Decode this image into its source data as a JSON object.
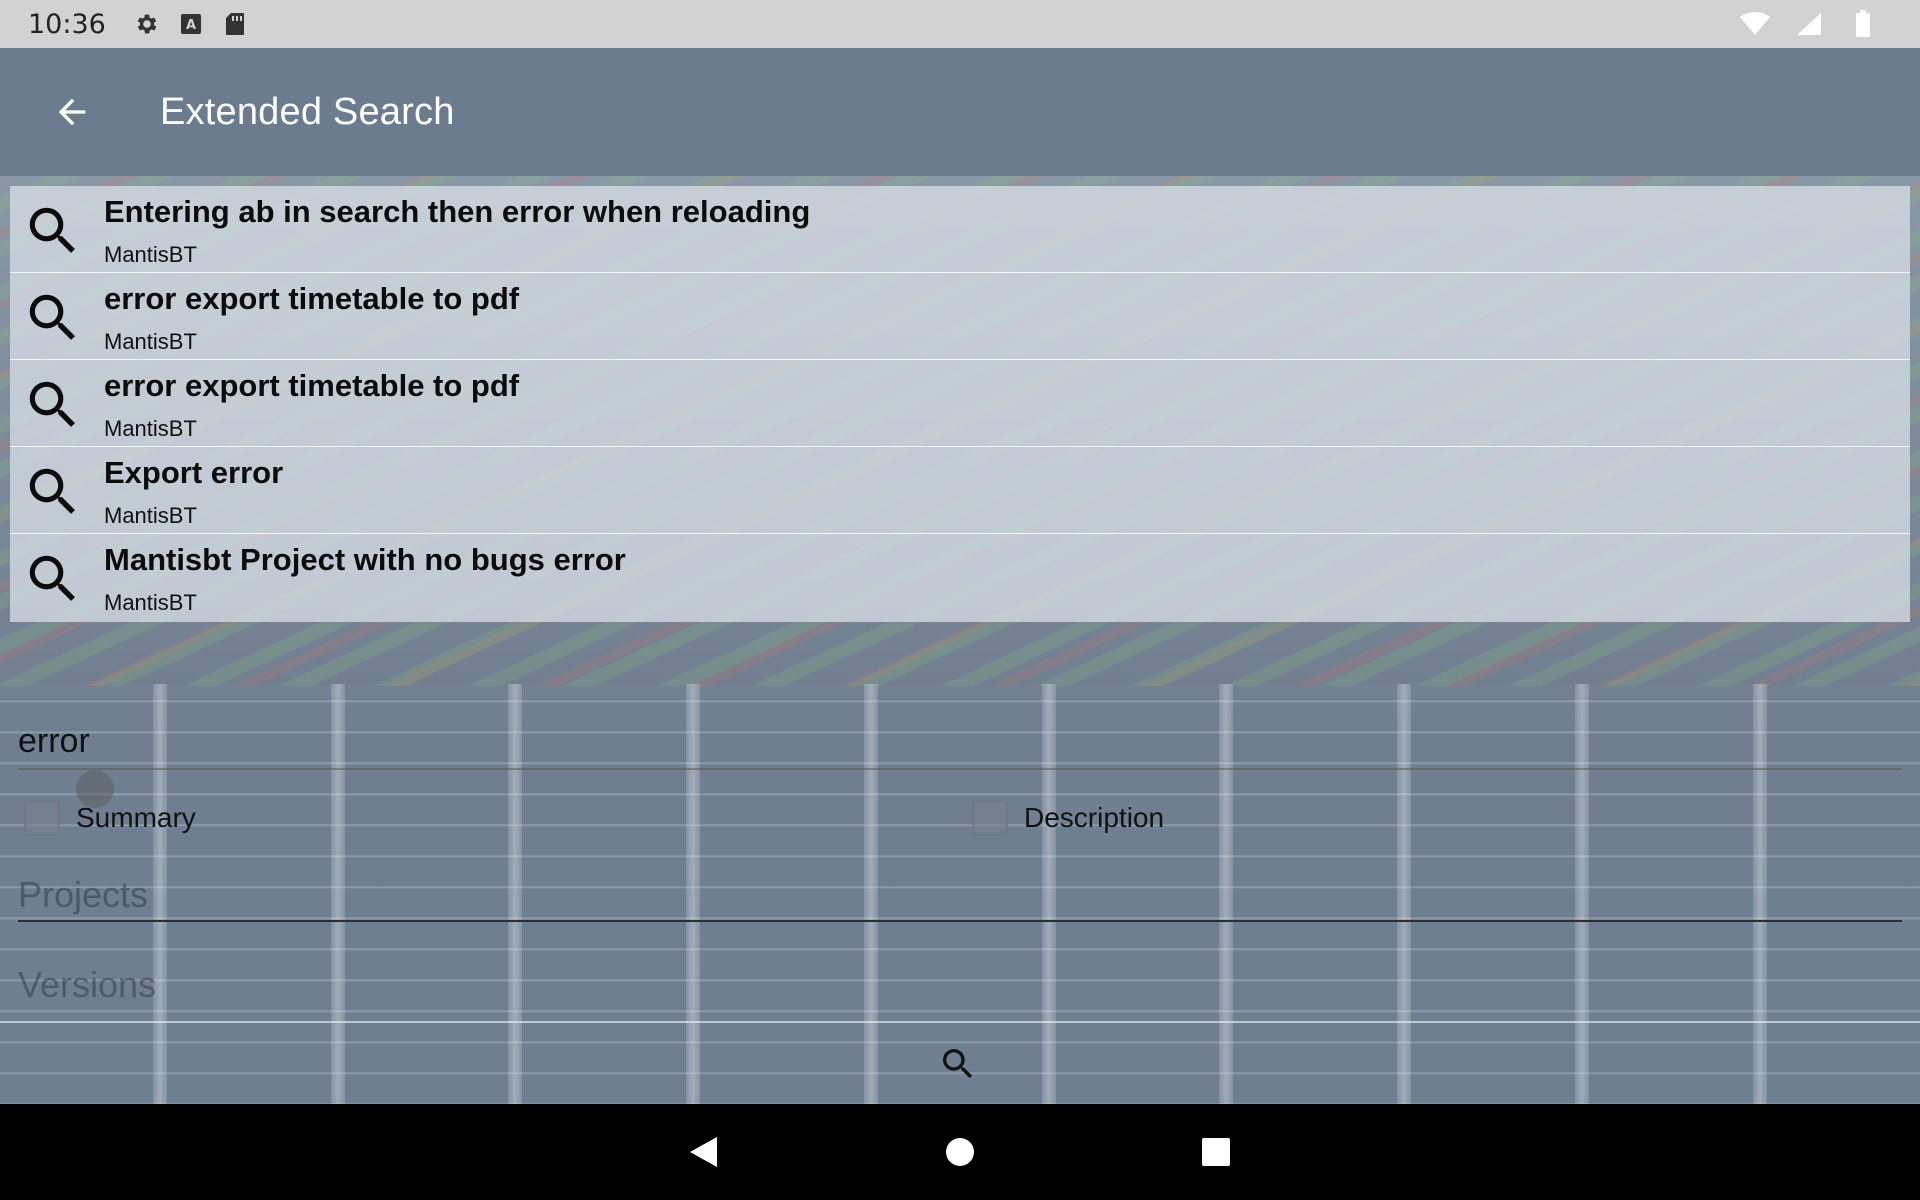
{
  "status_bar": {
    "time": "10:36",
    "icons_left": [
      "gear-icon",
      "keyboard-a-icon",
      "sd-card-icon"
    ],
    "icons_right": [
      "wifi-icon",
      "cell-signal-icon",
      "battery-icon"
    ]
  },
  "app_bar": {
    "title": "Extended Search",
    "back_icon": "arrow-back-icon"
  },
  "suggestions": [
    {
      "title": "Entering ab in search then error when reloading",
      "subtitle": "MantisBT"
    },
    {
      "title": "error export timetable to pdf",
      "subtitle": "MantisBT"
    },
    {
      "title": "error export timetable to pdf",
      "subtitle": "MantisBT"
    },
    {
      "title": "Export error",
      "subtitle": "MantisBT"
    },
    {
      "title": "Mantisbt Project with no bugs error",
      "subtitle": "MantisBT"
    }
  ],
  "form": {
    "search_value": "error",
    "summary_label": "Summary",
    "description_label": "Description",
    "projects_placeholder": "Projects",
    "versions_placeholder": "Versions"
  },
  "colors": {
    "app_bar": "#6b7c8e",
    "status_bar": "#d2d2d2",
    "nav_bar": "#000000"
  }
}
